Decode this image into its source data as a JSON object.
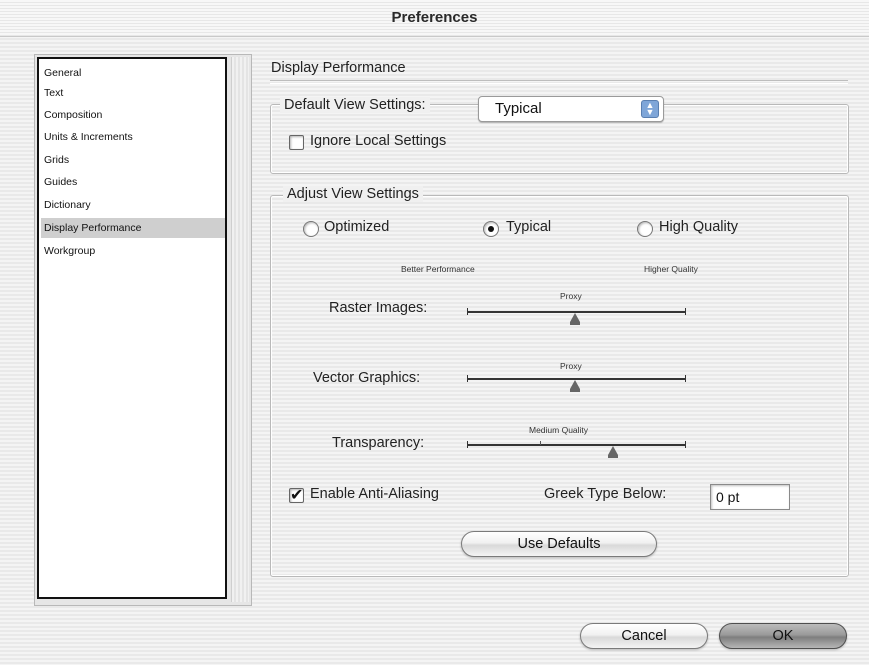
{
  "window": {
    "title": "Preferences"
  },
  "sidebar": {
    "items": [
      {
        "label": "General"
      },
      {
        "label": "Text"
      },
      {
        "label": "Composition"
      },
      {
        "label": "Units & Increments"
      },
      {
        "label": "Grids"
      },
      {
        "label": "Guides"
      },
      {
        "label": "Dictionary"
      },
      {
        "label": "Display Performance",
        "selected": true
      },
      {
        "label": "Workgroup"
      }
    ]
  },
  "main": {
    "section_title": "Display Performance",
    "default_view": {
      "label": "Default View Settings:",
      "selected_value": "Typical",
      "ignore_local_label": "Ignore Local Settings",
      "ignore_local_checked": false
    },
    "adjust_view": {
      "label": "Adjust View Settings",
      "radios": [
        {
          "label": "Optimized",
          "checked": false
        },
        {
          "label": "Typical",
          "checked": true
        },
        {
          "label": "High Quality",
          "checked": false
        }
      ],
      "caption_left": "Better Performance",
      "caption_right": "Higher Quality",
      "sliders": [
        {
          "label": "Raster Images:",
          "value_label": "Proxy",
          "position": 0.5
        },
        {
          "label": "Vector Graphics:",
          "value_label": "Proxy",
          "position": 0.5
        },
        {
          "label": "Transparency:",
          "value_label": "Medium Quality",
          "position": 0.67
        }
      ],
      "anti_aliasing_label": "Enable Anti-Aliasing",
      "anti_aliasing_checked": true,
      "greek_label": "Greek Type Below:",
      "greek_value": "0 pt",
      "use_defaults_label": "Use Defaults"
    }
  },
  "footer": {
    "cancel_label": "Cancel",
    "ok_label": "OK"
  },
  "colors": {
    "selection": "#cfcfcf",
    "popup_arrow": "#7fa6d8"
  }
}
